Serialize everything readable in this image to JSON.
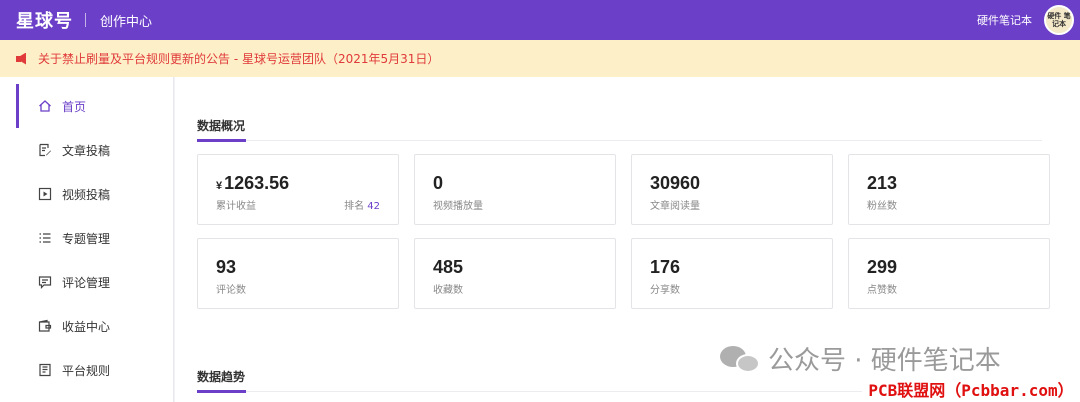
{
  "header": {
    "logo": "星球号",
    "section": "创作中心",
    "username": "硬件笔记本",
    "avatar_text": "硬件 笔记本"
  },
  "notice": {
    "text": "关于禁止刷量及平台规则更新的公告 - 星球号运营团队（2021年5月31日）",
    "color": "#e03a3a"
  },
  "sidebar": {
    "items": [
      {
        "label": "首页",
        "icon": "home-icon",
        "active": true
      },
      {
        "label": "文章投稿",
        "icon": "edit-document-icon"
      },
      {
        "label": "视频投稿",
        "icon": "video-icon"
      },
      {
        "label": "专题管理",
        "icon": "list-icon"
      },
      {
        "label": "评论管理",
        "icon": "comment-icon"
      },
      {
        "label": "收益中心",
        "icon": "wallet-icon"
      },
      {
        "label": "平台规则",
        "icon": "rules-document-icon"
      }
    ]
  },
  "overview": {
    "title": "数据概况",
    "cards": [
      {
        "currency": "¥",
        "value": "1263.56",
        "label": "累计收益",
        "rank_label": "排名",
        "rank": "42"
      },
      {
        "value": "0",
        "label": "视频播放量"
      },
      {
        "value": "30960",
        "label": "文章阅读量"
      },
      {
        "value": "213",
        "label": "粉丝数"
      },
      {
        "value": "93",
        "label": "评论数"
      },
      {
        "value": "485",
        "label": "收藏数"
      },
      {
        "value": "176",
        "label": "分享数"
      },
      {
        "value": "299",
        "label": "点赞数"
      }
    ]
  },
  "trend": {
    "title": "数据趋势"
  },
  "watermarks": {
    "wechat": "公众号 · 硬件笔记本",
    "site": "PCB联盟网（Pcbbar.com）"
  },
  "colors": {
    "brand": "#6b3fc8",
    "notice_bg": "#fdefc8"
  }
}
